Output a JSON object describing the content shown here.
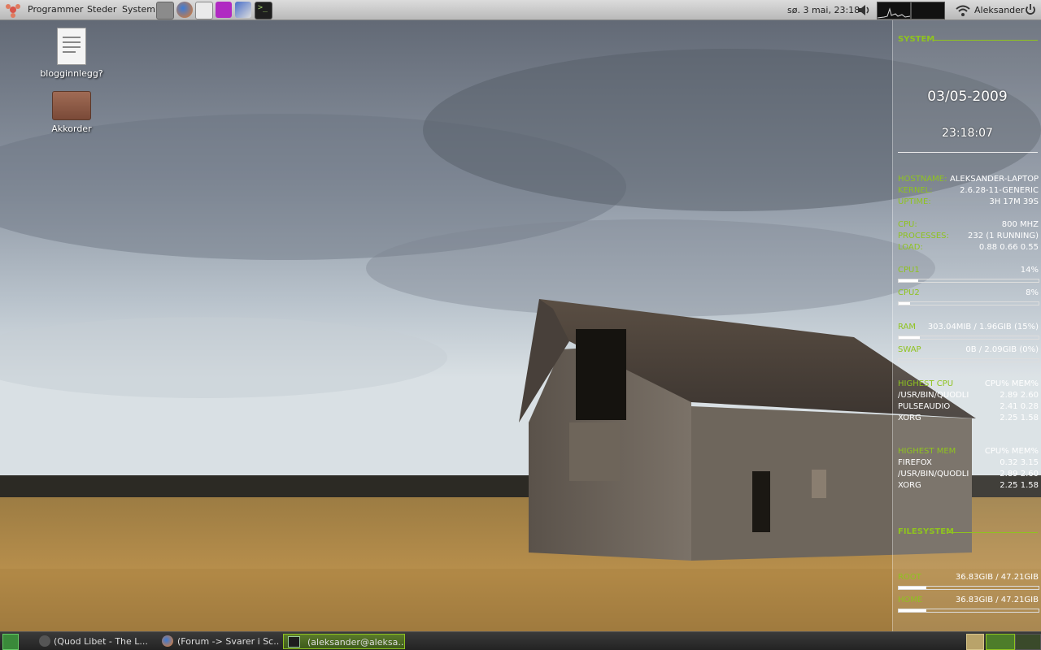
{
  "top_panel": {
    "menus": [
      "Programmer",
      "Steder",
      "System"
    ],
    "launchers": [
      "window-switcher-icon",
      "firefox-icon",
      "mail-icon",
      "image-editor-icon",
      "text-editor-icon",
      "terminal-icon"
    ],
    "clock": "sø. 3 mai, 23:18",
    "user": "Aleksander"
  },
  "desktop": {
    "icons": [
      {
        "label": "blogginnlegg?"
      },
      {
        "label": "Akkorder"
      }
    ]
  },
  "conky": {
    "system_header": "SYSTEM",
    "date": "03/05-2009",
    "time": "23:18:07",
    "hostname": {
      "key": "HOSTNAME:",
      "value": "ALEKSANDER-LAPTOP"
    },
    "kernel": {
      "key": "KERNEL:",
      "value": "2.6.28-11-GENERIC"
    },
    "uptime": {
      "key": "UPTIME:",
      "value": "3H 17M 39S"
    },
    "cpu": {
      "key": "CPU:",
      "value": "800 MHZ"
    },
    "processes": {
      "key": "PROCESSES:",
      "value": "232 (1 RUNNING)"
    },
    "load": {
      "key": "LOAD:",
      "value": "0.88 0.66 0.55"
    },
    "cpu1": {
      "key": "CPU1",
      "value": "14%",
      "fill": 0.14
    },
    "cpu2": {
      "key": "CPU2",
      "value": "8%",
      "fill": 0.08
    },
    "ram": {
      "key": "RAM",
      "value": "303.04MIB / 1.96GIB (15%)",
      "fill": 0.15
    },
    "swap": {
      "key": "SWAP",
      "value": "0B / 2.09GIB (0%)",
      "fill": 0.0
    },
    "highest_cpu": {
      "header": "HIGHEST CPU",
      "cols": "CPU% MEM%",
      "rows": [
        {
          "name": "/USR/BIN/QUODLI",
          "vals": "2.89  2.60"
        },
        {
          "name": "PULSEAUDIO",
          "vals": "2.41  0.28"
        },
        {
          "name": "XORG",
          "vals": "2.25  1.58"
        }
      ]
    },
    "highest_mem": {
      "header": "HIGHEST MEM",
      "cols": "CPU% MEM%",
      "rows": [
        {
          "name": "FIREFOX",
          "vals": "0.32  3.15"
        },
        {
          "name": "/USR/BIN/QUODLI",
          "vals": "2.89  2.60"
        },
        {
          "name": "XORG",
          "vals": "2.25  1.58"
        }
      ]
    },
    "filesystem_header": "FILESYSTEM",
    "root": {
      "key": "ROOT",
      "value": "36.83GIB / 47.21GIB",
      "fill": 0.2
    },
    "home": {
      "key": "HOME",
      "value": "36.83GIB / 47.21GIB",
      "fill": 0.2
    }
  },
  "taskbar": {
    "tasks": [
      {
        "label": "(Quod Libet - The L...",
        "icon": "music-player-icon"
      },
      {
        "label": "(Forum -> Svarer i Sc...",
        "icon": "firefox-icon"
      },
      {
        "label": "(aleksander@aleksa...",
        "icon": "terminal-icon"
      }
    ]
  },
  "colors": {
    "accent": "#8fc31f",
    "panel": "#c8c8c8",
    "taskbar": "#2a2a2a"
  }
}
